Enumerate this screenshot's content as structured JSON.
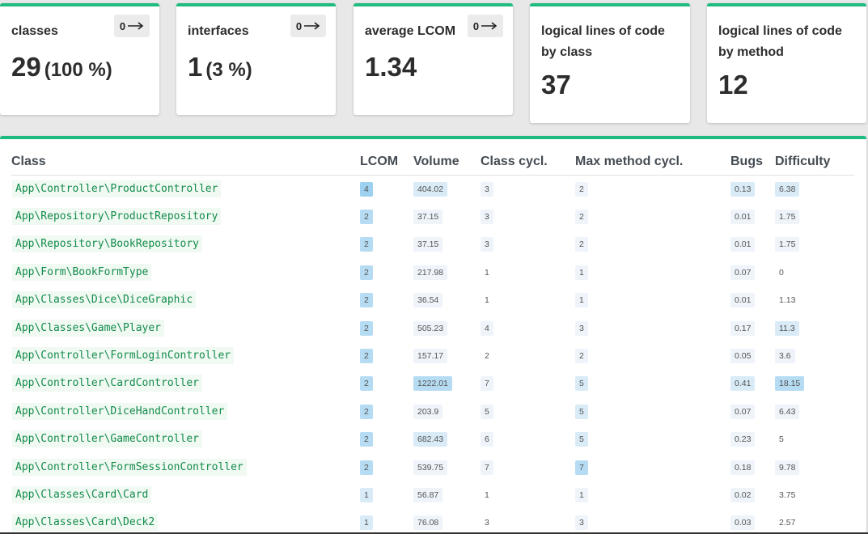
{
  "cards": [
    {
      "title": "classes",
      "value": "29",
      "pct": "(100 %)",
      "trend": "0"
    },
    {
      "title": "interfaces",
      "value": "1",
      "pct": "(3 %)",
      "trend": "0"
    },
    {
      "title": "average LCOM",
      "value": "1.34",
      "pct": "",
      "trend": "0"
    },
    {
      "title_line1": "logical lines of code",
      "title_line2": "by class",
      "value": "37"
    },
    {
      "title_line1": "logical lines of code",
      "title_line2": "by method",
      "value": "12"
    }
  ],
  "table": {
    "headers": [
      "Class",
      "LCOM",
      "Volume",
      "Class cycl.",
      "Max method cycl.",
      "Bugs",
      "Difficulty"
    ],
    "rows": [
      {
        "cls": "App\\Controller\\ProductController",
        "lcom": "4",
        "volume": "404.02",
        "ccycl": "3",
        "mcycl": "2",
        "bugs": "0.13",
        "difficulty": "6.38",
        "lv": [
          4,
          2,
          1,
          1,
          2,
          2
        ]
      },
      {
        "cls": "App\\Repository\\ProductRepository",
        "lcom": "2",
        "volume": "37.15",
        "ccycl": "3",
        "mcycl": "2",
        "bugs": "0.01",
        "difficulty": "1.75",
        "lv": [
          3,
          1,
          1,
          1,
          1,
          1
        ]
      },
      {
        "cls": "App\\Repository\\BookRepository",
        "lcom": "2",
        "volume": "37.15",
        "ccycl": "3",
        "mcycl": "2",
        "bugs": "0.01",
        "difficulty": "1.75",
        "lv": [
          3,
          1,
          1,
          1,
          1,
          1
        ]
      },
      {
        "cls": "App\\Form\\BookFormType",
        "lcom": "2",
        "volume": "217.98",
        "ccycl": "1",
        "mcycl": "1",
        "bugs": "0.07",
        "difficulty": "0",
        "lv": [
          3,
          1,
          0,
          1,
          1,
          0
        ]
      },
      {
        "cls": "App\\Classes\\Dice\\DiceGraphic",
        "lcom": "2",
        "volume": "36.54",
        "ccycl": "1",
        "mcycl": "1",
        "bugs": "0.01",
        "difficulty": "1.13",
        "lv": [
          3,
          1,
          0,
          1,
          1,
          0
        ]
      },
      {
        "cls": "App\\Classes\\Game\\Player",
        "lcom": "2",
        "volume": "505.23",
        "ccycl": "4",
        "mcycl": "3",
        "bugs": "0.17",
        "difficulty": "11.3",
        "lv": [
          3,
          1,
          1,
          1,
          1,
          2
        ]
      },
      {
        "cls": "App\\Controller\\FormLoginController",
        "lcom": "2",
        "volume": "157.17",
        "ccycl": "2",
        "mcycl": "2",
        "bugs": "0.05",
        "difficulty": "3.6",
        "lv": [
          3,
          1,
          0,
          1,
          1,
          1
        ]
      },
      {
        "cls": "App\\Controller\\CardController",
        "lcom": "2",
        "volume": "1222.01",
        "ccycl": "7",
        "mcycl": "5",
        "bugs": "0.41",
        "difficulty": "18.15",
        "lv": [
          3,
          3,
          1,
          2,
          2,
          3
        ]
      },
      {
        "cls": "App\\Controller\\DiceHandController",
        "lcom": "2",
        "volume": "203.9",
        "ccycl": "5",
        "mcycl": "5",
        "bugs": "0.07",
        "difficulty": "6.43",
        "lv": [
          3,
          1,
          1,
          2,
          1,
          1
        ]
      },
      {
        "cls": "App\\Controller\\GameController",
        "lcom": "2",
        "volume": "682.43",
        "ccycl": "6",
        "mcycl": "5",
        "bugs": "0.23",
        "difficulty": "5",
        "lv": [
          3,
          2,
          1,
          2,
          1,
          0
        ]
      },
      {
        "cls": "App\\Controller\\FormSessionController",
        "lcom": "2",
        "volume": "539.75",
        "ccycl": "7",
        "mcycl": "7",
        "bugs": "0.18",
        "difficulty": "9.78",
        "lv": [
          3,
          1,
          1,
          3,
          1,
          1
        ]
      },
      {
        "cls": "App\\Classes\\Card\\Card",
        "lcom": "1",
        "volume": "56.87",
        "ccycl": "1",
        "mcycl": "1",
        "bugs": "0.02",
        "difficulty": "3.75",
        "lv": [
          2,
          1,
          0,
          1,
          1,
          0
        ]
      },
      {
        "cls": "App\\Classes\\Card\\Deck2",
        "lcom": "1",
        "volume": "76.08",
        "ccycl": "3",
        "mcycl": "3",
        "bugs": "0.03",
        "difficulty": "2.57",
        "lv": [
          2,
          1,
          0,
          1,
          1,
          0
        ]
      }
    ]
  },
  "colors": {
    "accent": "#1fbc7f",
    "class_text": "#128c4a",
    "cell_highlight": "#9dd1ef"
  },
  "icons": {
    "trend": "arrow-right-icon"
  }
}
